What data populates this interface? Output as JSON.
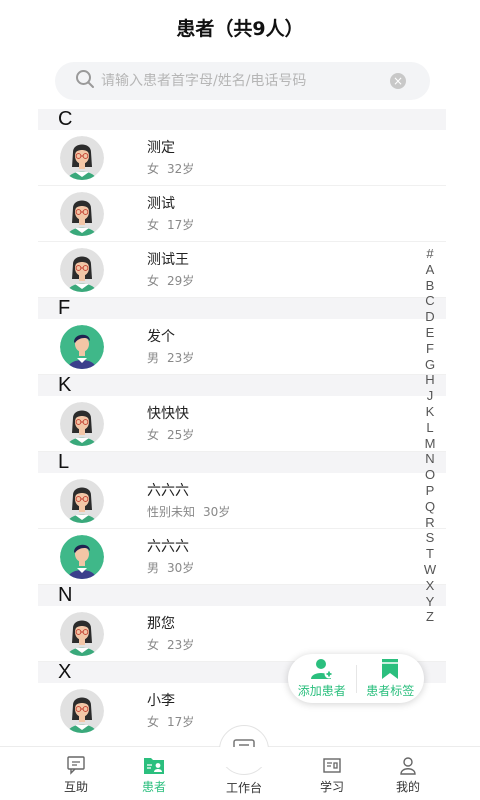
{
  "header": {
    "title": "患者（共9人）"
  },
  "search": {
    "placeholder": "请输入患者首字母/姓名/电话号码",
    "search_icon": "search-icon",
    "clear_icon": "close-circle-icon"
  },
  "sections": [
    {
      "letter": "C",
      "patients": [
        {
          "name": "测定",
          "gender": "女",
          "age": "32岁",
          "avatar": "female"
        },
        {
          "name": "测试",
          "gender": "女",
          "age": "17岁",
          "avatar": "female"
        },
        {
          "name": "测试王",
          "gender": "女",
          "age": "29岁",
          "avatar": "female"
        }
      ]
    },
    {
      "letter": "F",
      "patients": [
        {
          "name": "发个",
          "gender": "男",
          "age": "23岁",
          "avatar": "male"
        }
      ]
    },
    {
      "letter": "K",
      "patients": [
        {
          "name": "快快快",
          "gender": "女",
          "age": "25岁",
          "avatar": "female"
        }
      ]
    },
    {
      "letter": "L",
      "patients": [
        {
          "name": "六六六",
          "gender": "性别未知",
          "age": "30岁",
          "avatar": "female"
        },
        {
          "name": "六六六",
          "gender": "男",
          "age": "30岁",
          "avatar": "male"
        }
      ]
    },
    {
      "letter": "N",
      "patients": [
        {
          "name": "那您",
          "gender": "女",
          "age": "23岁",
          "avatar": "female"
        }
      ]
    },
    {
      "letter": "X",
      "patients": [
        {
          "name": "小李",
          "gender": "女",
          "age": "17岁",
          "avatar": "female"
        }
      ]
    }
  ],
  "index_letters": [
    "#",
    "A",
    "B",
    "C",
    "D",
    "E",
    "F",
    "G",
    "H",
    "J",
    "K",
    "L",
    "M",
    "N",
    "O",
    "P",
    "Q",
    "R",
    "S",
    "T",
    "W",
    "X",
    "Y",
    "Z"
  ],
  "fab": {
    "add_label": "添加患者",
    "tag_label": "患者标签"
  },
  "tabbar": {
    "items": [
      {
        "label": "互助",
        "icon": "chat-icon"
      },
      {
        "label": "患者",
        "icon": "patient-card-icon",
        "active": true
      },
      {
        "label": "工作台",
        "icon": "workbench-icon"
      },
      {
        "label": "学习",
        "icon": "study-icon"
      },
      {
        "label": "我的",
        "icon": "profile-icon"
      }
    ]
  },
  "colors": {
    "accent": "#2bbf7e",
    "section_bg": "#f4f4f6",
    "search_bg": "#f3f4f6"
  }
}
